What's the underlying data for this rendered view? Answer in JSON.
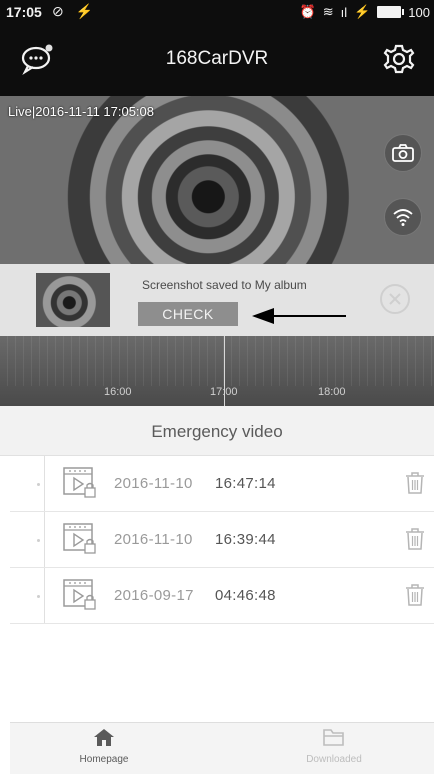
{
  "status_bar": {
    "time": "17:05",
    "battery": "100"
  },
  "header": {
    "title": "168CarDVR"
  },
  "video": {
    "live_label": "Live|2016-11-11 17:05:08"
  },
  "toast": {
    "message": "Screenshot saved to My album",
    "check_label": "CHECK"
  },
  "timeline": {
    "ticks": [
      "16:00",
      "17:00",
      "18:00"
    ]
  },
  "emergency": {
    "title": "Emergency video",
    "items": [
      {
        "date": "2016-11-10",
        "time": "16:47:14"
      },
      {
        "date": "2016-11-10",
        "time": "16:39:44"
      },
      {
        "date": "2016-09-17",
        "time": "04:46:48"
      }
    ]
  },
  "nav": {
    "home_label": "Homepage",
    "download_label": "Downloaded"
  },
  "colors": {
    "header_bg": "#0d0d0d",
    "toast_bg": "#e3e3e3",
    "check_btn": "#8e8e8e"
  }
}
